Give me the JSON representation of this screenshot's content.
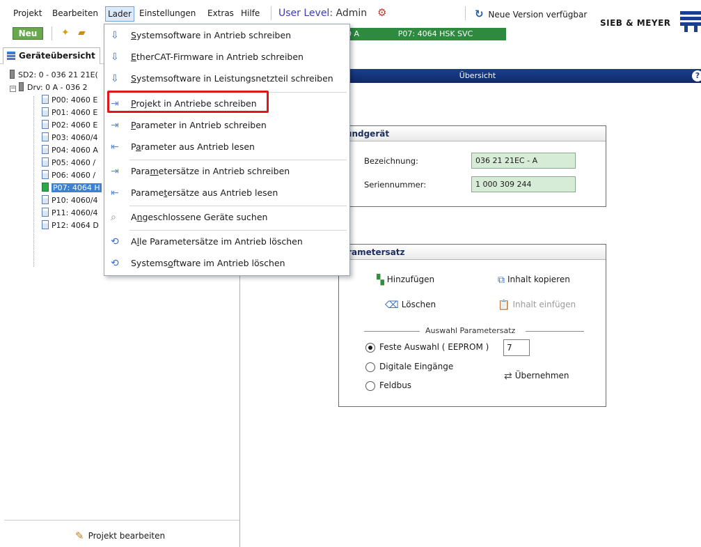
{
  "menubar": {
    "items": [
      "Projekt",
      "Bearbeiten",
      "Lader",
      "Einstellungen",
      "Extras",
      "Hilfe"
    ],
    "user_level_label": "User Level:",
    "user_level_value": "Admin",
    "update_text": "Neue Version verfügbar",
    "brand": "SIEB & MEYER"
  },
  "toolbar": {
    "new_label": "Neu",
    "status_drive": "0 A",
    "status_parameter": "P07: 4064 HSK SVC"
  },
  "left_panel": {
    "tab_label": "Geräteübersicht",
    "tree": {
      "root": "SD2: 0 - 036 21 21E(",
      "drive": "Drv: 0 A - 036 2",
      "parameters": [
        "P00: 4060 E",
        "P01: 4060 E",
        "P02: 4060 E",
        "P03: 4060/4",
        "P04: 4060 A",
        "P05: 4060 /",
        "P06: 4060 /",
        "P07: 4064 H",
        "P10: 4060/4",
        "P11: 4060/4",
        "P12: 4064 D"
      ]
    },
    "footer_button": "Projekt bearbeiten"
  },
  "main": {
    "header_title": "Übersicht",
    "grundgeraet": {
      "title": "rundgerät",
      "bezeichnung_label": "Bezeichnung:",
      "bezeichnung_value": "036 21 21EC - A",
      "seriennummer_label": "Seriennummer:",
      "seriennummer_value": "1 000 309 244"
    },
    "parametersatz": {
      "title": "arametersatz",
      "hinzufuegen": "Hinzufügen",
      "inhalt_kopieren": "Inhalt kopieren",
      "loeschen": "Löschen",
      "inhalt_einfuegen": "Inhalt einfügen",
      "auswahl_title": "Auswahl Parametersatz",
      "radio_feste": "Feste Auswahl ( EEPROM )",
      "radio_digital": "Digitale Eingänge",
      "radio_feldbus": "Feldbus",
      "eeprom_value": "7",
      "uebernehmen": "Übernehmen"
    }
  },
  "dropdown": {
    "items": [
      {
        "prefix": "",
        "key": "S",
        "rest": "ystemsoftware in Antrieb schreiben"
      },
      {
        "prefix": "",
        "key": "E",
        "rest": "therCAT-Firmware in Antrieb schreiben"
      },
      {
        "prefix": "",
        "key": "S",
        "rest": "ystemsoftware in Leistungsnetzteil schreiben"
      },
      {
        "prefix": "",
        "key": "P",
        "rest": "rojekt in Antriebe schreiben"
      },
      {
        "prefix": "",
        "key": "P",
        "rest": "arameter in Antrieb schreiben"
      },
      {
        "prefix": "P",
        "key": "a",
        "rest": "rameter aus Antrieb lesen"
      },
      {
        "prefix": "Para",
        "key": "m",
        "rest": "etersätze in Antrieb schreiben"
      },
      {
        "prefix": "Parame",
        "key": "t",
        "rest": "ersätze aus Antrieb lesen"
      },
      {
        "prefix": "A",
        "key": "n",
        "rest": "geschlossene Geräte suchen"
      },
      {
        "prefix": "A",
        "key": "l",
        "rest": "le Parametersätze im Antrieb löschen"
      },
      {
        "prefix": "Systems",
        "key": "o",
        "rest": "ftware im Antrieb löschen"
      }
    ]
  },
  "colors": {
    "accent_blue": "#1a3f8f",
    "status_green": "#2d8a3e",
    "highlight_red": "#e0161b",
    "field_green": "#d6ecd6"
  }
}
